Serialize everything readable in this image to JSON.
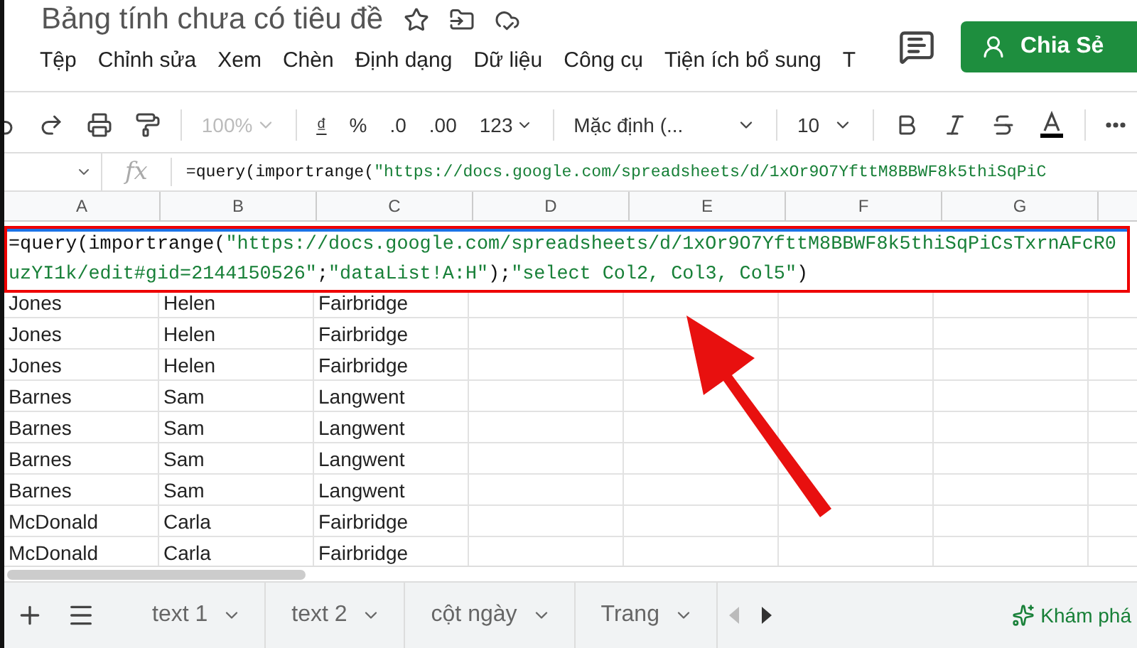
{
  "title": "Bảng tính chưa có tiêu đề",
  "share_button": "Chia Sẻ",
  "menu": [
    "Tệp",
    "Chỉnh sửa",
    "Xem",
    "Chèn",
    "Định dạng",
    "Dữ liệu",
    "Công cụ",
    "Tiện ích bổ sung",
    "T"
  ],
  "toolbar": {
    "zoom": "100%",
    "currency": "₫",
    "percent": "%",
    "decrease_decimal": ".0",
    "increase_decimal": ".00",
    "number_format": "123",
    "font": "Mặc định (...",
    "font_size": "10"
  },
  "formula_bar": {
    "fx_label": "fx",
    "parts": [
      {
        "kind": "code",
        "text": "=query(importrange("
      },
      {
        "kind": "string",
        "text": "\"https://docs.google.com/spreadsheets/d/1xOr9O7YfttM8BBWF8k5thiSqPiC"
      }
    ]
  },
  "columns": [
    "A",
    "B",
    "C",
    "D",
    "E",
    "F",
    "G"
  ],
  "cell_editor": {
    "parts": [
      {
        "kind": "code",
        "text": "=query(importrange("
      },
      {
        "kind": "string",
        "text": "\"https://docs.google.com/spreadsheets/d/1xOr9O7YfttM8BBWF8k5thiSqPiCsTxrnAFcR0uzYI1k/edit#gid=2144150526\""
      },
      {
        "kind": "code",
        "text": ";"
      },
      {
        "kind": "string",
        "text": "\"dataList!A:H\""
      },
      {
        "kind": "code",
        "text": ");"
      },
      {
        "kind": "string",
        "text": "\"select Col2, Col3, Col5\""
      },
      {
        "kind": "code",
        "text": ")"
      }
    ]
  },
  "rows": [
    [
      "Jones",
      "Helen",
      "Fairbridge"
    ],
    [
      "Jones",
      "Helen",
      "Fairbridge"
    ],
    [
      "Jones",
      "Helen",
      "Fairbridge"
    ],
    [
      "Barnes",
      "Sam",
      "Langwent"
    ],
    [
      "Barnes",
      "Sam",
      "Langwent"
    ],
    [
      "Barnes",
      "Sam",
      "Langwent"
    ],
    [
      "Barnes",
      "Sam",
      "Langwent"
    ],
    [
      "McDonald",
      "Carla",
      "Fairbridge"
    ],
    [
      "McDonald",
      "Carla",
      "Fairbridge"
    ]
  ],
  "sheet_tabs": [
    {
      "label": "text 1",
      "selected": false
    },
    {
      "label": "text 2",
      "selected": false
    },
    {
      "label": "cột ngày",
      "selected": false
    },
    {
      "label": "Trang",
      "selected": false
    }
  ],
  "explore_button": "Khám phá"
}
